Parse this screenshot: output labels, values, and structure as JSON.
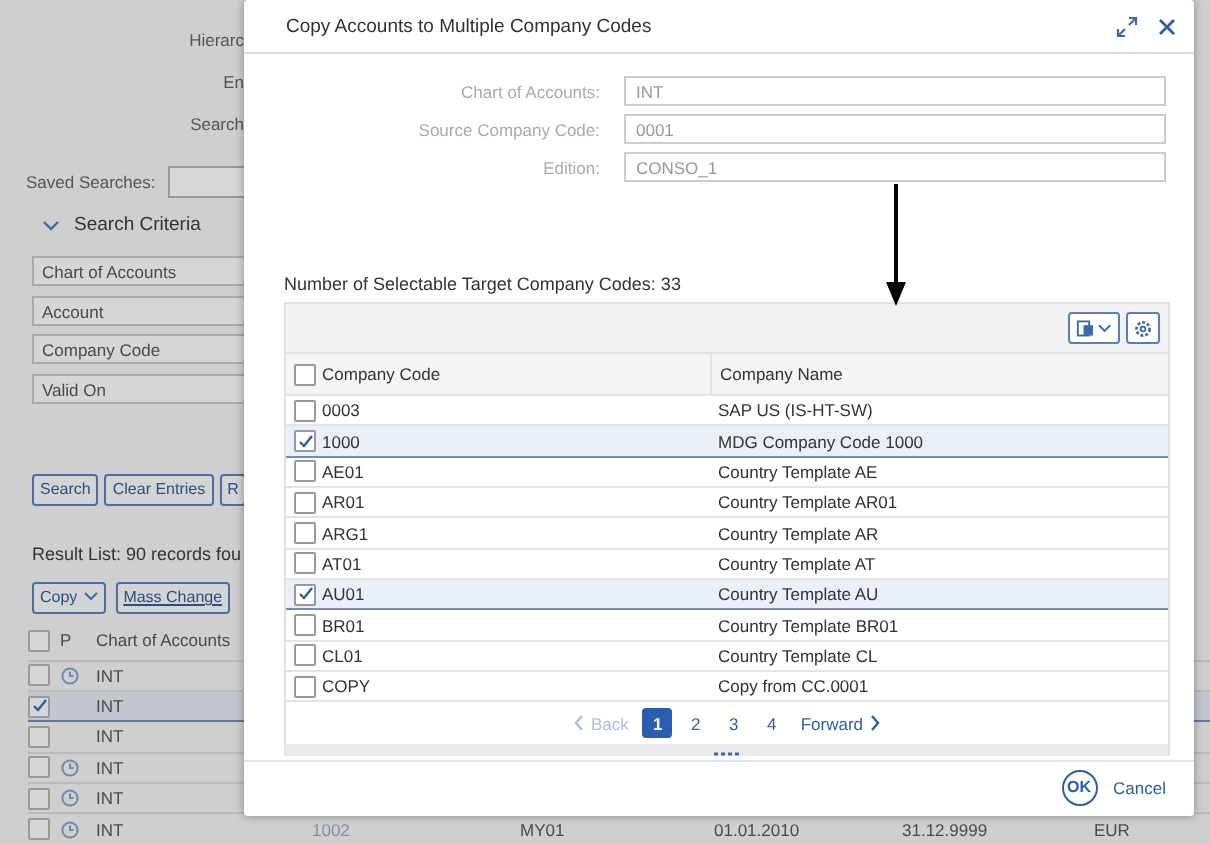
{
  "background": {
    "labels": [
      "Hierarc",
      "En",
      "Search"
    ],
    "saved_searches_label": "Saved Searches:",
    "search_criteria": {
      "title": "Search Criteria",
      "expanded": true,
      "fields": [
        "Chart of Accounts",
        "Account",
        "Company Code",
        "Valid On"
      ]
    },
    "buttons": [
      "Search",
      "Clear Entries",
      "R"
    ],
    "result_count": "Result List: 90 records fou",
    "toolbar": [
      {
        "kind": "menu",
        "label": "Copy"
      },
      {
        "kind": "link",
        "label": "Mass Change"
      }
    ],
    "table": {
      "select_all": false,
      "pending_column": "P",
      "columns": [
        "Chart of Accounts"
      ],
      "rows": [
        {
          "selected": false,
          "pending": true,
          "cells": [
            "INT"
          ]
        },
        {
          "selected": true,
          "pending": false,
          "cells": [
            "INT"
          ]
        },
        {
          "selected": false,
          "pending": false,
          "cells": [
            "INT"
          ]
        },
        {
          "selected": false,
          "pending": true,
          "cells": [
            "INT"
          ]
        },
        {
          "selected": false,
          "pending": true,
          "cells": [
            "INT"
          ]
        },
        {
          "selected": false,
          "pending": true,
          "cells": [
            "INT",
            "1002",
            "MY01",
            "01.01.2010",
            "31.12.9999",
            "EUR"
          ]
        }
      ]
    }
  },
  "dialog": {
    "title": "Copy Accounts to Multiple Company Codes",
    "fields": [
      {
        "label": "Chart of Accounts:",
        "value": "INT",
        "disabled": true
      },
      {
        "label": "Source Company Code:",
        "value": "0001",
        "disabled": true
      },
      {
        "label": "Edition:",
        "value": "CONSO_1",
        "disabled": true
      }
    ],
    "count": "Number of Selectable Target Company Codes: 33",
    "table": {
      "select_all": false,
      "columns": [
        "Company Code",
        "Company Name"
      ],
      "rows": [
        {
          "selected": false,
          "cells": [
            "0003",
            "SAP US (IS-HT-SW)"
          ]
        },
        {
          "selected": true,
          "cells": [
            "1000",
            "MDG Company Code 1000"
          ]
        },
        {
          "selected": false,
          "cells": [
            "AE01",
            "Country Template AE"
          ]
        },
        {
          "selected": false,
          "cells": [
            "AR01",
            "Country Template AR01"
          ]
        },
        {
          "selected": false,
          "cells": [
            "ARG1",
            "Country Template AR"
          ]
        },
        {
          "selected": false,
          "cells": [
            "AT01",
            "Country Template AT"
          ]
        },
        {
          "selected": true,
          "cells": [
            "AU01",
            "Country Template AU"
          ]
        },
        {
          "selected": false,
          "cells": [
            "BR01",
            "Country Template BR01"
          ]
        },
        {
          "selected": false,
          "cells": [
            "CL01",
            "Country Template CL"
          ]
        },
        {
          "selected": false,
          "cells": [
            "COPY",
            "Copy from CC.0001"
          ]
        }
      ]
    },
    "pagination": {
      "back": {
        "label": "Back",
        "disabled": true
      },
      "pages": [
        {
          "label": "1",
          "selected": true
        },
        {
          "label": "2",
          "selected": false
        },
        {
          "label": "3",
          "selected": false
        },
        {
          "label": "4",
          "selected": false
        }
      ],
      "forward": {
        "label": "Forward",
        "disabled": false
      }
    },
    "buttons": [
      {
        "kind": "primary",
        "label": "OK"
      },
      {
        "kind": "secondary",
        "label": "Cancel"
      }
    ]
  }
}
